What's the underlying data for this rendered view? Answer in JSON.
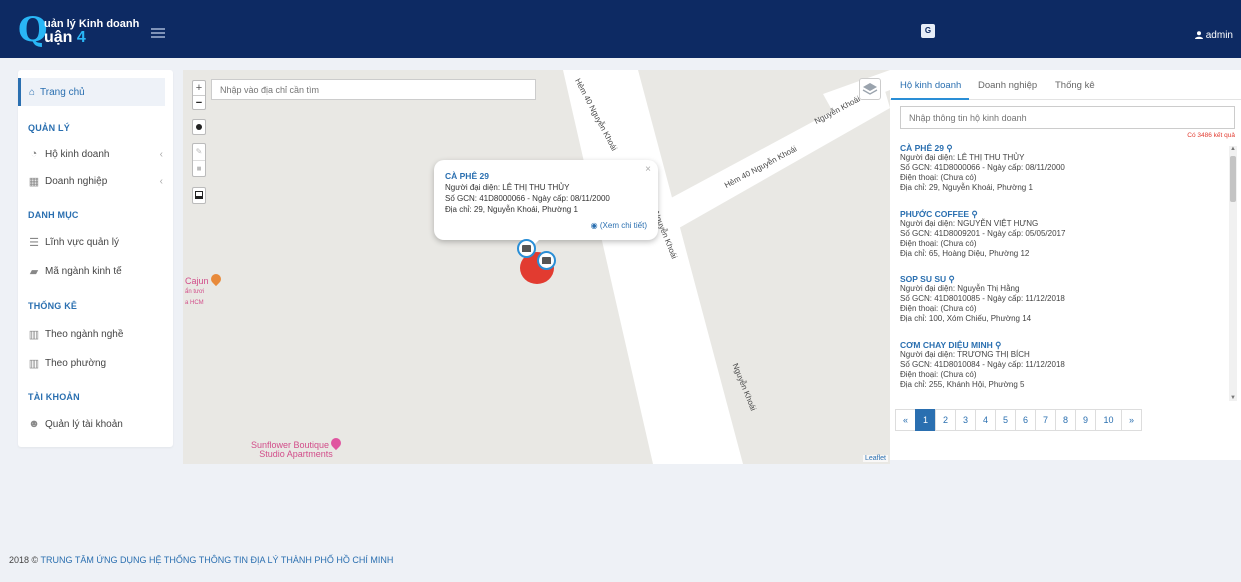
{
  "header": {
    "logo_letter": "Q",
    "logo_line1": "uản lý Kinh doanh",
    "logo_line2_text": "uận",
    "logo_line2_num": "4",
    "user_label": "admin",
    "icons": [
      "menu-icon",
      "translate-icon",
      "user-icon"
    ]
  },
  "sidebar": {
    "home": "Trang chủ",
    "sections": {
      "manage": "QUẢN LÝ",
      "catalog": "DANH MỤC",
      "stats": "THỐNG KÊ",
      "account": "TÀI KHOẢN"
    },
    "items": {
      "household": "Hộ kinh doanh",
      "enterprise": "Doanh nghiệp",
      "field": "Lĩnh vực quản lý",
      "econ_code": "Mã ngành kinh tế",
      "by_industry": "Theo ngành nghề",
      "by_ward": "Theo phường",
      "accounts": "Quản lý tài khoản"
    }
  },
  "map": {
    "search_placeholder": "Nhập vào địa chỉ cần tìm",
    "zoom_in": "+",
    "zoom_out": "−",
    "road_labels": {
      "r1": "Hẻm 40 Nguyễn Khoái",
      "r2": "Hẻm 40 Nguyễn Khoái",
      "r3": "Nguyễn Khoái",
      "r4": "Nguyễn Khoái",
      "r5": "Nguyễn Khoái"
    },
    "poi": {
      "cajun_line1": "Cajun",
      "cajun_line2": "ẩn tươi",
      "cajun_line3": "a HCM",
      "sunflower_line1": "Sunflower Boutique",
      "sunflower_line2": "Studio Apartments"
    },
    "attribution": "Leaflet",
    "popup": {
      "title": "CÀ PHÊ 29",
      "rep": "Người đại diện: LÊ THỊ THU THỦY",
      "cert": "Số GCN: 41D8000066 - Ngày cấp: 08/11/2000",
      "address": "Địa chỉ: 29, Nguyễn Khoái, Phường 1",
      "link": "(Xem chi tiết)",
      "close": "×"
    }
  },
  "panel": {
    "tabs": [
      "Hộ kinh doanh",
      "Doanh nghiệp",
      "Thống kê"
    ],
    "search_placeholder": "Nhập thông tin hộ kinh doanh",
    "count": "Có 3486 kết quả",
    "results": [
      {
        "name": "CÀ PHÊ 29",
        "rep": "Người đại diện: LÊ THỊ THU THỦY",
        "cert": "Số GCN: 41D8000066 - Ngày cấp: 08/11/2000",
        "phone": "Điện thoại: (Chưa có)",
        "address": "Địa chỉ: 29, Nguyễn Khoái, Phường 1"
      },
      {
        "name": "PHƯỚC COFFEE",
        "rep": "Người đại diện: NGUYỄN VIỆT HƯNG",
        "cert": "Số GCN: 41D8009201 - Ngày cấp: 05/05/2017",
        "phone": "Điện thoại: (Chưa có)",
        "address": "Địa chỉ: 65, Hoàng Diệu, Phường 12"
      },
      {
        "name": "SOP SU SU",
        "rep": "Người đại diện: Nguyễn Thị Hằng",
        "cert": "Số GCN: 41D8010085 - Ngày cấp: 11/12/2018",
        "phone": "Điện thoại: (Chưa có)",
        "address": "Địa chỉ: 100, Xóm Chiếu, Phường 14"
      },
      {
        "name": "CƠM CHAY DIỆU MINH",
        "rep": "Người đại diện: TRƯƠNG THỊ BÍCH",
        "cert": "Số GCN: 41D8010084 - Ngày cấp: 11/12/2018",
        "phone": "Điện thoại: (Chưa có)",
        "address": "Địa chỉ: 255, Khánh Hội, Phường 5"
      }
    ],
    "pagination": [
      "«",
      "1",
      "2",
      "3",
      "4",
      "5",
      "6",
      "7",
      "8",
      "9",
      "10",
      "»"
    ],
    "current_page": "1"
  },
  "footer": {
    "year": "2018 ©",
    "org": "TRUNG TÂM ỨNG DỤNG HỆ THỐNG THÔNG TIN ĐỊA LÝ THÀNH PHỐ HỒ CHÍ MINH"
  },
  "colors": {
    "header_bg": "#0d2a63",
    "accent": "#2a6fb0",
    "cluster": "#e23b30"
  }
}
